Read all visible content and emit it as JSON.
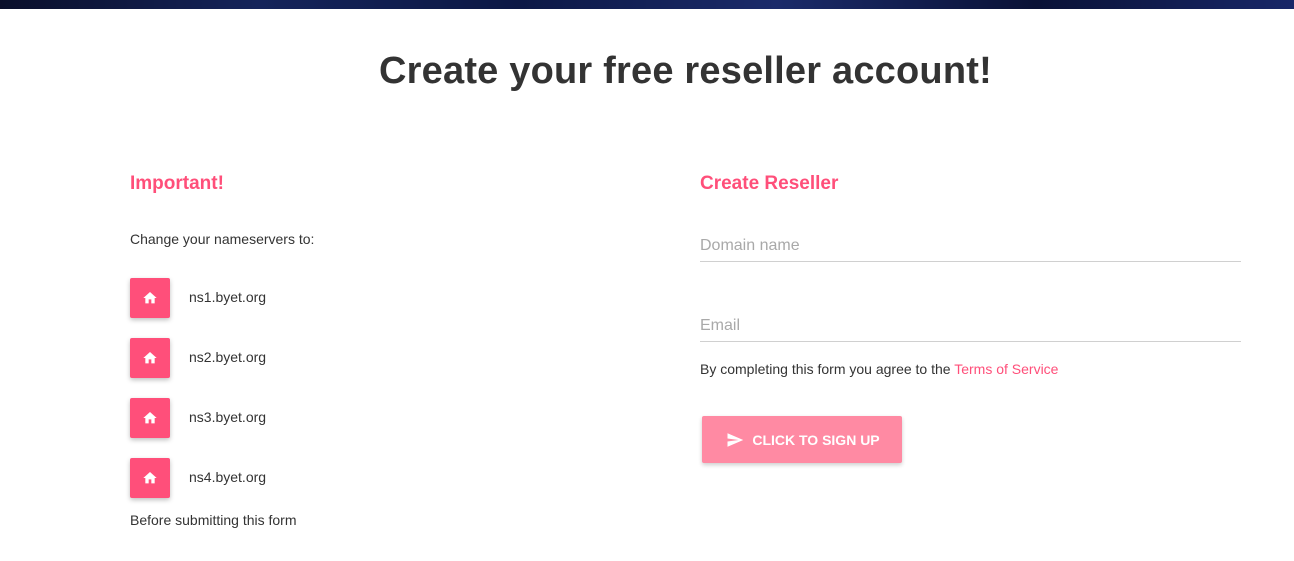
{
  "page": {
    "title": "Create your free reseller account!"
  },
  "important": {
    "title": "Important!",
    "instruction": "Change your nameservers to:",
    "nameservers": [
      {
        "label": "ns1.byet.org",
        "icon": "home-icon"
      },
      {
        "label": "ns2.byet.org",
        "icon": "home-icon"
      },
      {
        "label": "ns3.byet.org",
        "icon": "home-icon"
      },
      {
        "label": "ns4.byet.org",
        "icon": "home-icon"
      }
    ],
    "footer": "Before submitting this form"
  },
  "form": {
    "title": "Create Reseller",
    "domain": {
      "placeholder": "Domain name",
      "value": ""
    },
    "email": {
      "placeholder": "Email",
      "value": ""
    },
    "agree_text": "By completing this form you agree to the ",
    "tos_label": "Terms of Service",
    "submit_label": "CLICK TO SIGN UP",
    "submit_icon": "send-icon"
  },
  "colors": {
    "accent": "#ff4f7a",
    "button": "#ff8aa3",
    "heading": "#333333"
  }
}
